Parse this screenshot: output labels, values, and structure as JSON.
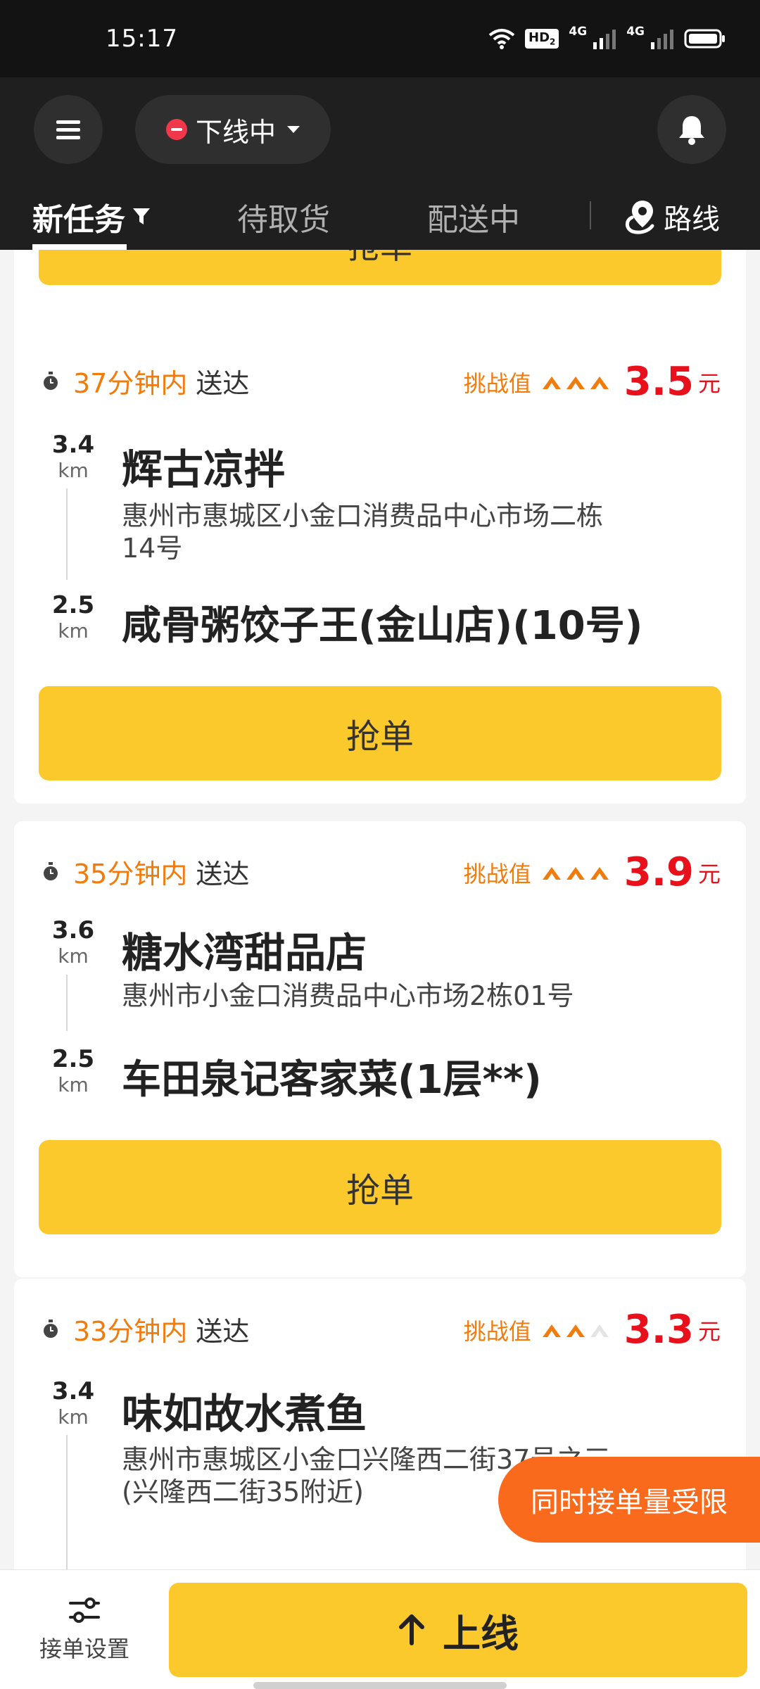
{
  "status_bar": {
    "time": "15:17",
    "hd": "HD",
    "sub": "2",
    "net1": "4G",
    "net2": "4G"
  },
  "header": {
    "status_label": "下线中",
    "tabs": [
      {
        "label": "新任务",
        "active": true
      },
      {
        "label": "待取货",
        "active": false
      },
      {
        "label": "配送中",
        "active": false
      }
    ],
    "route_label": "路线"
  },
  "partial_card": {
    "button_label": "抢单"
  },
  "cards": [
    {
      "eta": "37分钟内",
      "eta_suffix": "送达",
      "challenge_label": "挑战值",
      "challenge_level": 3,
      "price": "3.5",
      "unit": "元",
      "pickup_distance": "3.4",
      "pickup_unit": "km",
      "shop_name": "辉古凉拌",
      "shop_address_line1": "惠州市惠城区小金口消费品中心市场二栋",
      "shop_address_line2": "14号",
      "dropoff_distance": "2.5",
      "dropoff_unit": "km",
      "destination": "咸骨粥饺子王(金山店)(10号)",
      "button_label": "抢单"
    },
    {
      "eta": "35分钟内",
      "eta_suffix": "送达",
      "challenge_label": "挑战值",
      "challenge_level": 3,
      "price": "3.9",
      "unit": "元",
      "pickup_distance": "3.6",
      "pickup_unit": "km",
      "shop_name": "糖水湾甜品店",
      "shop_address_line1": "惠州市小金口消费品中心市场2栋01号",
      "dropoff_distance": "2.5",
      "dropoff_unit": "km",
      "destination": "车田泉记客家菜(1层**)",
      "button_label": "抢单"
    },
    {
      "eta": "33分钟内",
      "eta_suffix": "送达",
      "challenge_label": "挑战值",
      "challenge_level": 2,
      "price": "3.3",
      "unit": "元",
      "pickup_distance": "3.4",
      "pickup_unit": "km",
      "shop_name": "味如故水煮鱼",
      "shop_address_line1": "惠州市惠城区小金口兴隆西二街37号之三",
      "shop_address_line2": "(兴隆西二街35附近)"
    }
  ],
  "toast": "同时接单量受限",
  "bottom": {
    "settings_label": "接单设置",
    "online_label": "上线"
  },
  "colors": {
    "accent_yellow": "#fcc92d",
    "eta_orange": "#f07c0d",
    "price_red": "#e8101a",
    "toast_orange": "#fa6a1d",
    "header_dark": "#1f1f1f"
  }
}
